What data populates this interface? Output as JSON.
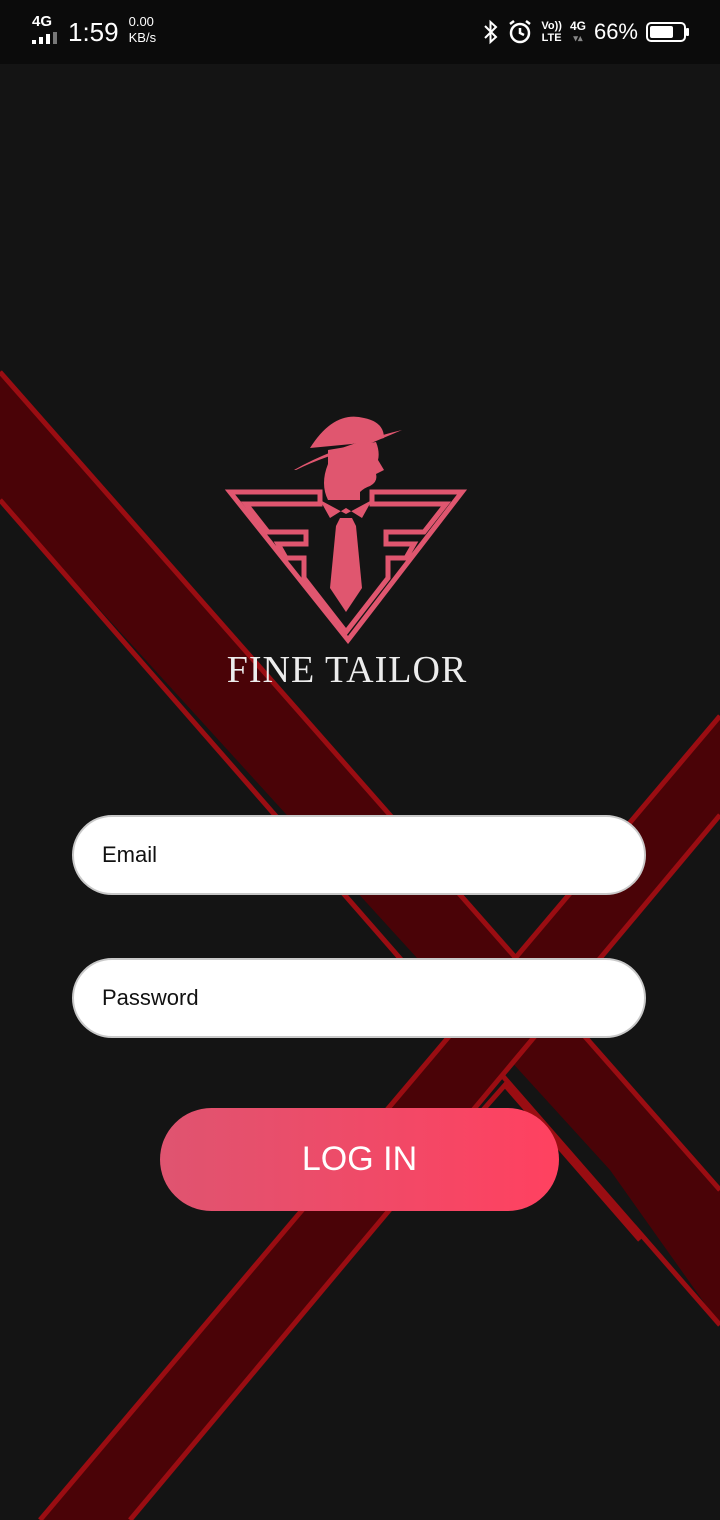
{
  "status_bar": {
    "network": "4G",
    "time": "1:59",
    "speed_value": "0.00",
    "speed_unit": "KB/s",
    "volte_top": "Vo))",
    "volte_bottom": "LTE",
    "net_right": "4G",
    "battery_percent": "66%",
    "icons": [
      "bluetooth-icon",
      "alarm-icon",
      "battery-icon"
    ]
  },
  "brand": {
    "name": "FINE TAILOR"
  },
  "login_form": {
    "email_placeholder": "Email",
    "password_placeholder": "Password",
    "login_label": "LOG IN"
  },
  "colors": {
    "background": "#141414",
    "accent": "#e0566f",
    "stripe_dark": "#4a0307",
    "stripe_edge": "#9a0d12",
    "button_gradient_start": "#df5470",
    "button_gradient_end": "#ff4160"
  }
}
